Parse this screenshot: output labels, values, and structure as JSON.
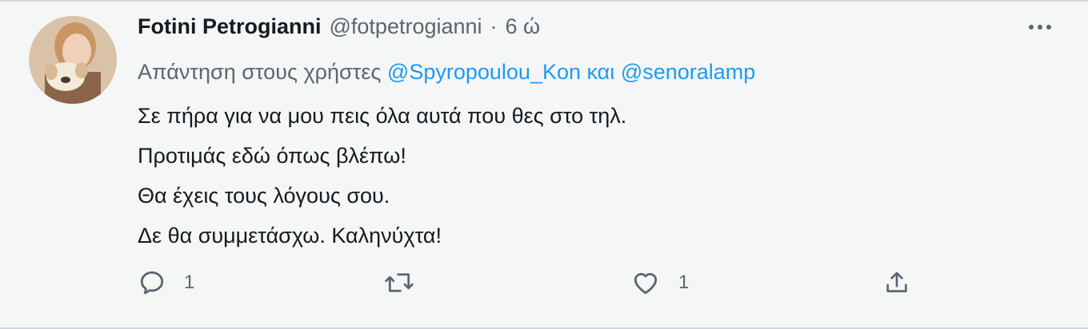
{
  "tweet": {
    "display_name": "Fotini Petrogianni",
    "handle": "@fotpetrogianni",
    "separator": "·",
    "time": "6 ώ",
    "reply_prefix": "Απάντηση στους χρήστες",
    "reply_mentions": [
      "@Spyropoulou_Kon",
      "@senoralamp"
    ],
    "reply_joiner": "και",
    "lines": [
      "Σε πήρα για να μου πεις όλα αυτά που θες στο τηλ.",
      "Προτιμάς εδώ όπως βλέπω!",
      "Θα έχεις τους λόγους σου.",
      "Δε θα συμμετάσχω. Καληνύχτα!"
    ]
  },
  "actions": {
    "reply": {
      "icon": "reply-icon",
      "count": "1"
    },
    "retweet": {
      "icon": "retweet-icon",
      "count": ""
    },
    "like": {
      "icon": "heart-icon",
      "count": "1"
    },
    "share": {
      "icon": "share-icon",
      "count": ""
    }
  },
  "colors": {
    "background": "#f5f6f6",
    "text": "#161b21",
    "secondary": "#5c6670",
    "link": "#1d9bf0"
  }
}
